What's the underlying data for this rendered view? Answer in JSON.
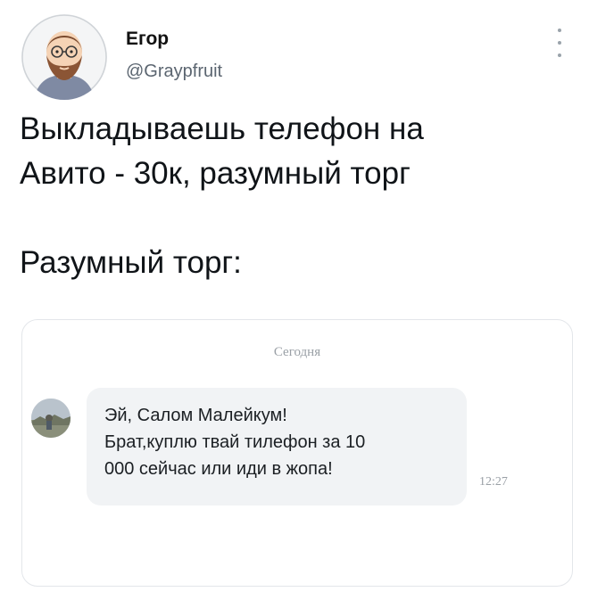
{
  "author": {
    "name": "Егор",
    "handle": "@Graypfruit"
  },
  "tweet": {
    "lines": [
      "Выкладываешь телефон на",
      "Авито - 30к, разумный торг",
      "Разумный торг:"
    ]
  },
  "chat": {
    "date_label": "Сегодня",
    "message": {
      "lines": [
        "Эй, Салом Малейкум!",
        "Брат,куплю твай тилефон за 10",
        "000 сейчас или иди в жопа!"
      ],
      "time": "12:27"
    }
  }
}
